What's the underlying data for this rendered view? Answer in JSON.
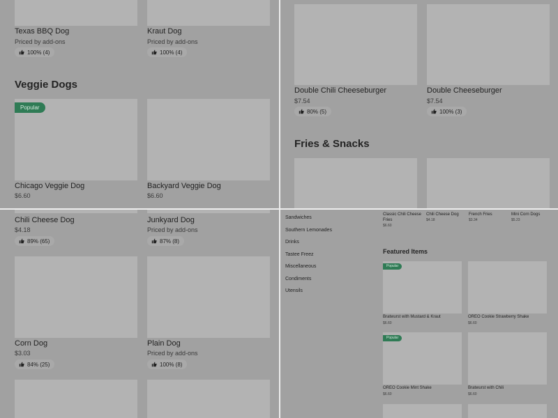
{
  "top_left": {
    "items": [
      {
        "name": "Texas BBQ Dog",
        "price": "Priced by add-ons",
        "rating": "100% (4)"
      },
      {
        "name": "Kraut Dog",
        "price": "Priced by add-ons",
        "rating": "100% (4)"
      }
    ],
    "section_title": "Veggie Dogs",
    "veggie_items": [
      {
        "badge": "Popular",
        "name": "Chicago Veggie Dog",
        "price": "$6.60"
      },
      {
        "name": "Backyard Veggie Dog",
        "price": "$6.60"
      }
    ]
  },
  "top_right": {
    "items": [
      {
        "name": "Double Chili Cheeseburger",
        "price": "$7.54",
        "rating": "80% (5)"
      },
      {
        "name": "Double Cheeseburger",
        "price": "$7.54",
        "rating": "100% (3)"
      }
    ],
    "section_title": "Fries & Snacks"
  },
  "bottom_left": {
    "items": [
      {
        "name": "Chili Cheese Dog",
        "price": "$4.18",
        "rating": "89% (65)"
      },
      {
        "name": "Junkyard Dog",
        "price": "Priced by add-ons",
        "rating": "87% (8)"
      },
      {
        "name": "Corn Dog",
        "price": "$3.03",
        "rating": "84% (25)"
      },
      {
        "name": "Plain Dog",
        "price": "Priced by add-ons",
        "rating": "100% (8)"
      }
    ]
  },
  "bottom_right": {
    "nav": [
      "Sandwiches",
      "Southern Lemonades",
      "Drinks",
      "Tastee Freez",
      "Miscellaneous",
      "Condiments",
      "Utensils"
    ],
    "top_items": [
      {
        "name": "Classic Chili Cheese Fries",
        "price": "$6.60"
      },
      {
        "name": "Chili Cheese Dog",
        "price": "$4.18"
      },
      {
        "name": "French Fries",
        "price": "$3.34"
      },
      {
        "name": "Mini Corn Dogs",
        "price": "$5.23"
      }
    ],
    "featured_title": "Featured Items",
    "featured": [
      {
        "badge": "Popular",
        "name": "Bratwurst with Mustard & Kraut",
        "price": "$6.60"
      },
      {
        "name": "OREO Cookie Strawberry Shake",
        "price": "$6.60"
      },
      {
        "badge": "Popular",
        "name": "OREO Cookie Mint Shake",
        "price": "$6.60"
      },
      {
        "name": "Bratwurst with Chili",
        "price": "$6.60"
      }
    ]
  },
  "icons": {
    "rating": "thumbs-up-icon"
  },
  "colors": {
    "badge": "#2f7b55",
    "overlay": "#a1a1a1",
    "thumbnail": "#b3b3b3"
  }
}
